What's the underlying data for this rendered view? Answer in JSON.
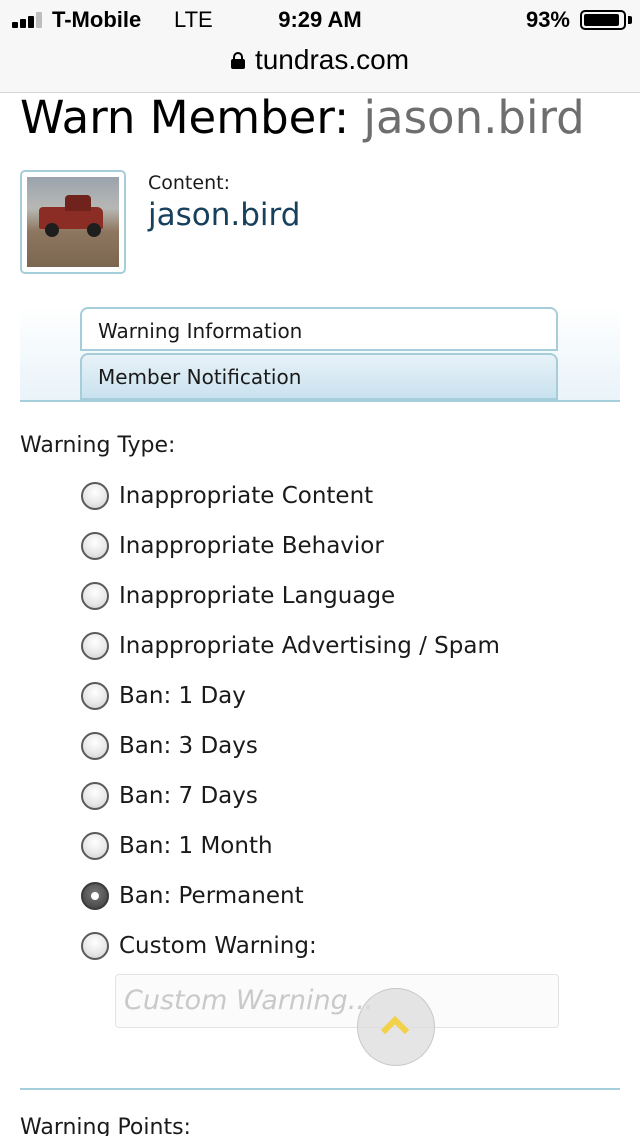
{
  "status_bar": {
    "carrier": "T-Mobile",
    "network": "LTE",
    "time": "9:29 AM",
    "battery_percent": "93%",
    "battery_level": 0.93,
    "signal_bars": 3
  },
  "url_bar": {
    "domain": "tundras.com",
    "secure_icon": "lock-icon"
  },
  "page": {
    "title_prefix": "Warn Member:",
    "title_username": "jason.bird",
    "content_label": "Content:",
    "content_link": "jason.bird",
    "tabs": [
      {
        "label": "Warning Information",
        "active": true
      },
      {
        "label": "Member Notification",
        "active": false
      }
    ],
    "warning_type_label": "Warning Type:",
    "warning_options": [
      {
        "label": "Inappropriate Content",
        "checked": false
      },
      {
        "label": "Inappropriate Behavior",
        "checked": false
      },
      {
        "label": "Inappropriate Language",
        "checked": false
      },
      {
        "label": "Inappropriate Advertising / Spam",
        "checked": false
      },
      {
        "label": "Ban: 1 Day",
        "checked": false
      },
      {
        "label": "Ban: 3 Days",
        "checked": false
      },
      {
        "label": "Ban: 7 Days",
        "checked": false
      },
      {
        "label": "Ban: 1 Month",
        "checked": false
      },
      {
        "label": "Ban: Permanent",
        "checked": true
      },
      {
        "label": "Custom Warning:",
        "checked": false
      }
    ],
    "custom_warning_placeholder": "Custom Warning...",
    "scroll_top_icon": "chevron-up-icon",
    "next_section_label": "Warning Points:"
  },
  "colors": {
    "accent_border": "#a6cdda",
    "link": "#16405b",
    "username_gray": "#6e6e6e",
    "scroll_chevron": "#f2d14b"
  }
}
